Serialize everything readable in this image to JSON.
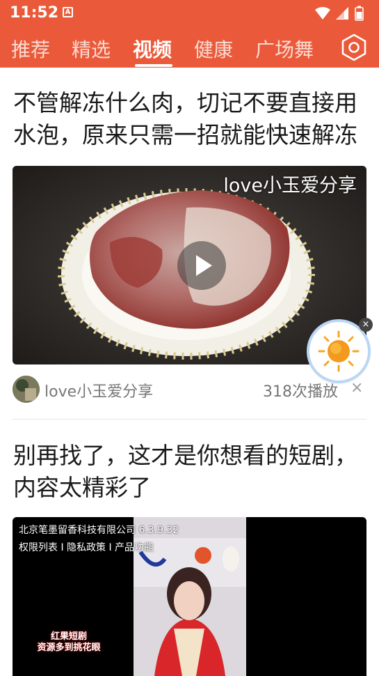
{
  "status_bar": {
    "time": "11:52",
    "notification_icon": "A"
  },
  "tabs": [
    {
      "label": "推荐"
    },
    {
      "label": "精选"
    },
    {
      "label": "视频",
      "active": true
    },
    {
      "label": "健康"
    },
    {
      "label": "广场舞"
    }
  ],
  "colors": {
    "accent": "#ea5a3a",
    "text": "#1a1a1a",
    "muted": "#777777"
  },
  "feed": [
    {
      "title_lines": [
        "不管解冻什么肉，切记不要直接用",
        "水泡，原来只需一招就能快速解冻"
      ],
      "watermark": "love小玉爱分享",
      "author": "love小玉爱分享",
      "plays": "318次播放",
      "dismiss": "×"
    },
    {
      "title_lines": [
        "别再找了，这才是你想看的短剧，",
        "内容太精彩了"
      ],
      "overlay_line1": "北京笔墨留香科技有限公司  6.3.9.32",
      "overlay_line2": "权限列表 I 隐私政策 I 产品功能",
      "caption_lines": [
        "红果短剧",
        "资源多到挑花眼"
      ]
    }
  ],
  "floating_widget": {
    "icon": "sun-icon",
    "close": "×"
  }
}
